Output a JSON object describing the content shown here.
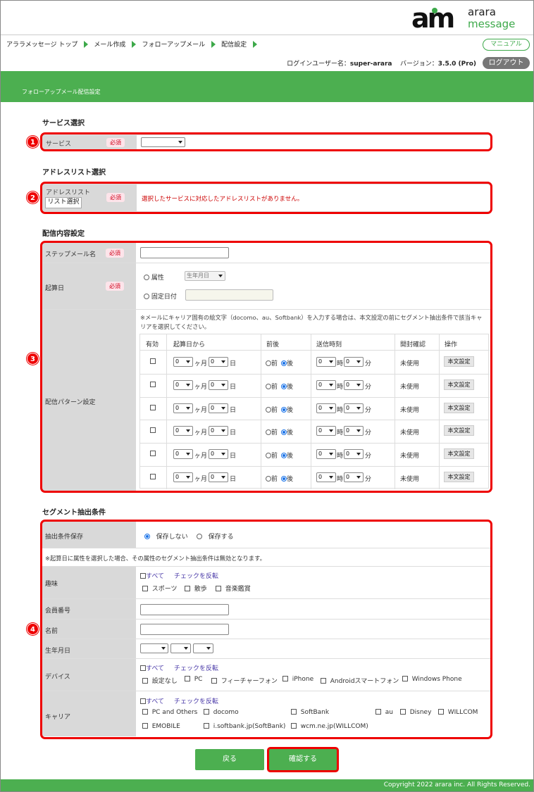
{
  "brand": {
    "mark": "am",
    "word1": "arara",
    "word2": "message"
  },
  "breadcrumb": [
    "アララメッセージ トップ",
    "メール作成",
    "フォローアップメール",
    "配信設定"
  ],
  "header": {
    "manual_label": "マニュアル",
    "login_label": "ログインユーザー名：",
    "login_user": "super-arara",
    "version_label": "バージョン：",
    "version_value": "3.5.0 (Pro)",
    "logout_label": "ログアウト"
  },
  "page_title": "フォローアップメール配信設定",
  "required": "必須",
  "callouts": [
    "1",
    "2",
    "3",
    "4"
  ],
  "service": {
    "title": "サービス選択",
    "label": "サービス",
    "value": ""
  },
  "address": {
    "title": "アドレスリスト選択",
    "label": "アドレスリスト",
    "button": "リスト選択",
    "message": "選択したサービスに対応したアドレスリストがありません。"
  },
  "content": {
    "title": "配信内容設定",
    "step_label": "ステップメール名",
    "base_label": "起算日",
    "attr_label": "属性",
    "attr_select": "生年月日",
    "fixed_label": "固定日付",
    "pattern_label": "配信パターン設定",
    "note": "※メールにキャリア固有の絵文字（docomo、au、Softbank）を入力する場合は、本文設定の前にセグメント抽出条件で該当キャリアを選択してください。",
    "columns": [
      "有効",
      "起算日から",
      "前後",
      "送信時刻",
      "開封確認",
      "操作"
    ],
    "months_unit": "ヶ月",
    "days_unit": "日",
    "before": "前",
    "after": "後",
    "hour_unit": "時",
    "min_unit": "分",
    "rows": [
      {
        "months": "0",
        "days": "0",
        "hour": "0",
        "minute": "0",
        "status": "未使用",
        "action": "本文設定"
      },
      {
        "months": "0",
        "days": "0",
        "hour": "0",
        "minute": "0",
        "status": "未使用",
        "action": "本文設定"
      },
      {
        "months": "0",
        "days": "0",
        "hour": "0",
        "minute": "0",
        "status": "未使用",
        "action": "本文設定"
      },
      {
        "months": "0",
        "days": "0",
        "hour": "0",
        "minute": "0",
        "status": "未使用",
        "action": "本文設定"
      },
      {
        "months": "0",
        "days": "0",
        "hour": "0",
        "minute": "0",
        "status": "未使用",
        "action": "本文設定"
      },
      {
        "months": "0",
        "days": "0",
        "hour": "0",
        "minute": "0",
        "status": "未使用",
        "action": "本文設定"
      }
    ]
  },
  "segment": {
    "title": "セグメント抽出条件",
    "save_label": "抽出条件保存",
    "save_no": "保存しない",
    "save_yes": "保存する",
    "note": "※起算日に属性を選択した場合、その属性のセグメント抽出条件は無効となります。",
    "hobby_label": "趣味",
    "all_label": "すべて",
    "invert_label": "チェックを反転",
    "hobbies": [
      "スポーツ",
      "散歩",
      "音楽鑑賞"
    ],
    "member_label": "会員番号",
    "name_label": "名前",
    "birth_label": "生年月日",
    "device_label": "デバイス",
    "devices": [
      "設定なし",
      "PC",
      "フィーチャーフォン",
      "iPhone",
      "Androidスマートフォン",
      "Windows Phone"
    ],
    "carrier_label": "キャリア",
    "carriers_row1": [
      "PC and Others",
      "docomo",
      "SoftBank",
      "au",
      "Disney",
      "WILLCOM"
    ],
    "carriers_row2": [
      "EMOBILE",
      "i.softbank.jp(SoftBank)",
      "wcm.ne.jp(WILLCOM)"
    ]
  },
  "actions": {
    "back": "戻る",
    "confirm": "確認する"
  },
  "footer": "Copyright 2022 arara inc. All Rights Reserved.",
  "colors": {
    "brand_green": "#4caf50",
    "highlight_red": "#e00000",
    "required_red": "#d0021b"
  }
}
